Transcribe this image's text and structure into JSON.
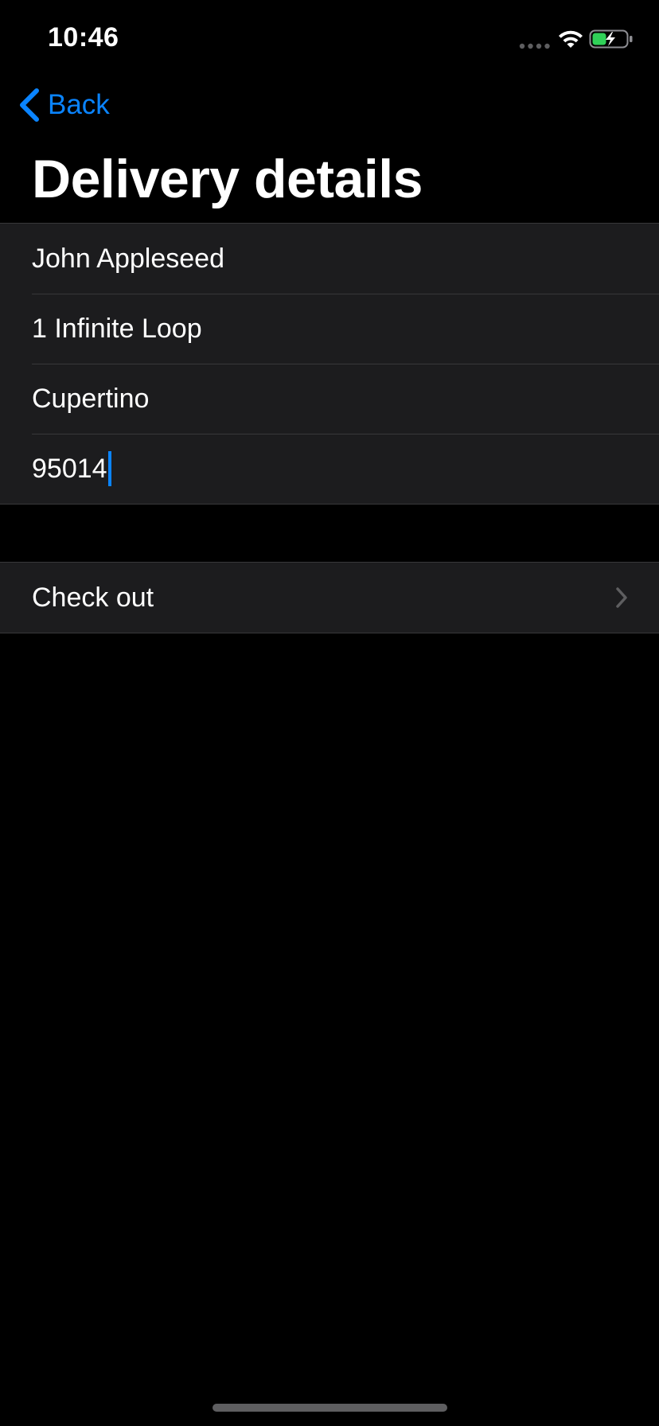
{
  "status_bar": {
    "time": "10:46",
    "icons": [
      "signal-dots-icon",
      "wifi-icon",
      "battery-charging-icon"
    ],
    "battery_color": "#30d158"
  },
  "nav": {
    "back_label": "Back",
    "accent_color": "#0a84ff"
  },
  "page": {
    "title": "Delivery details"
  },
  "form": {
    "name": "John Appleseed",
    "street": "1 Infinite Loop",
    "city": "Cupertino",
    "zip": "95014"
  },
  "checkout": {
    "label": "Check out",
    "icon": "chevron-right-icon"
  }
}
